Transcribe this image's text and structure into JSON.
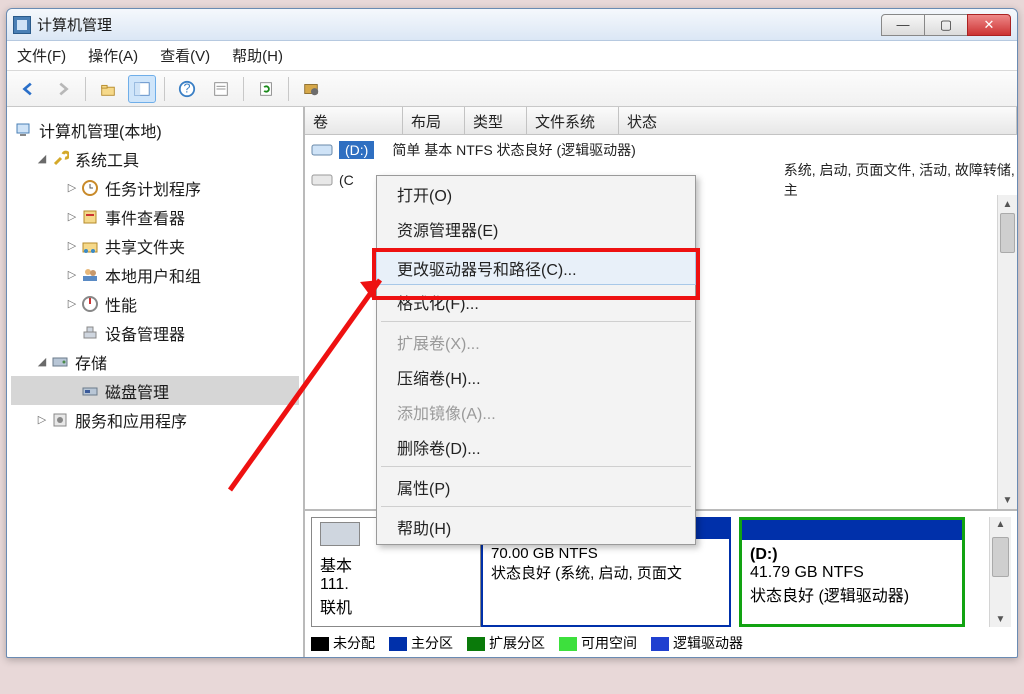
{
  "window": {
    "title": "计算机管理"
  },
  "menubar": {
    "file": "文件(F)",
    "action": "操作(A)",
    "view": "查看(V)",
    "help": "帮助(H)"
  },
  "tree": {
    "root": "计算机管理(本地)",
    "systools": "系统工具",
    "task": "任务计划程序",
    "event": "事件查看器",
    "shared": "共享文件夹",
    "users": "本地用户和组",
    "perf": "性能",
    "device": "设备管理器",
    "storage": "存储",
    "diskmgmt": "磁盘管理",
    "services": "服务和应用程序"
  },
  "list": {
    "hdr_vol": "卷",
    "hdr_layout": "布局",
    "hdr_type": "类型",
    "hdr_fs": "文件系统",
    "hdr_status": "状态",
    "row_d_label": "(D:)",
    "row_d_rest": "简单    基本    NTFS        状态良好 (逻辑驱动器)",
    "row_c_label": "(C",
    "row_c_rest": "系统, 启动, 页面文件, 活动, 故障转储, 主"
  },
  "context": {
    "open": "打开(O)",
    "explore": "资源管理器(E)",
    "change": "更改驱动器号和路径(C)...",
    "format": "格式化(F)...",
    "extend": "扩展卷(X)...",
    "shrink": "压缩卷(H)...",
    "mirror": "添加镜像(A)...",
    "delete": "删除卷(D)...",
    "props": "属性(P)",
    "help": "帮助(H)"
  },
  "diskpane": {
    "disk_label": "基本",
    "disk_size": "111.",
    "disk_online": "联机",
    "part_c_status": "状态良好 (系统, 启动, 页面文",
    "part_c_fs": "70.00 GB NTFS",
    "part_d_label": "(D:)",
    "part_d_size": "41.79 GB NTFS",
    "part_d_status": "状态良好 (逻辑驱动器)"
  },
  "legend": {
    "unalloc": "未分配",
    "primary": "主分区",
    "extended": "扩展分区",
    "free": "可用空间",
    "logical": "逻辑驱动器"
  }
}
